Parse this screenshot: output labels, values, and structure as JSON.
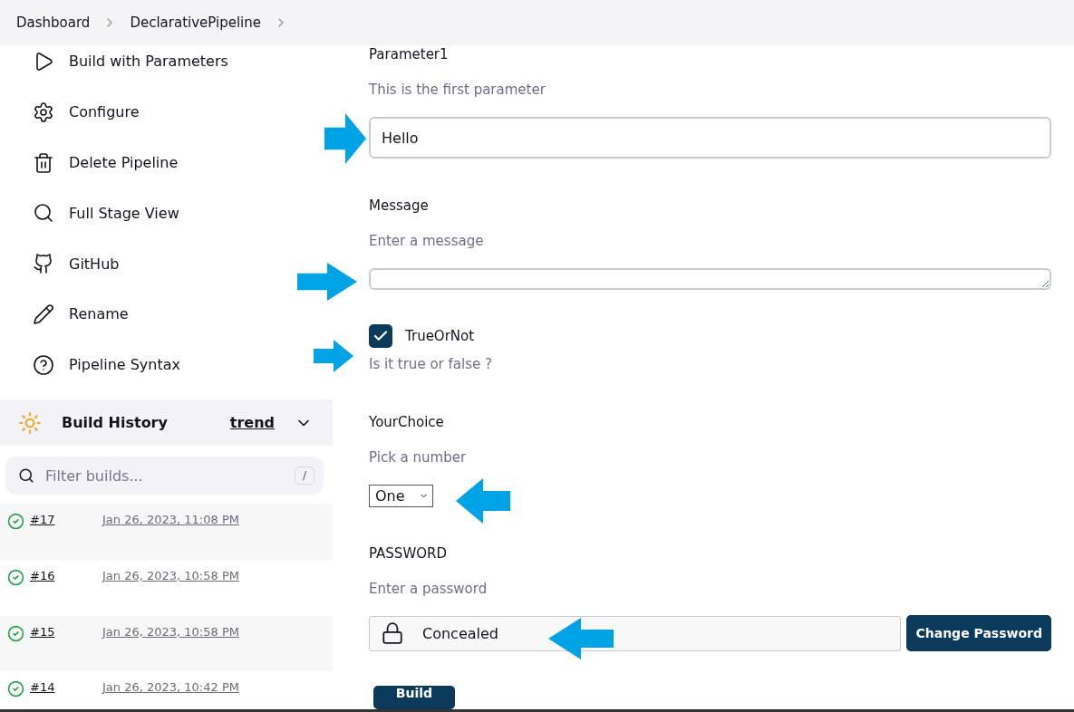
{
  "breadcrumbs": [
    {
      "label": "Dashboard"
    },
    {
      "label": "DeclarativePipeline"
    }
  ],
  "sidebar": {
    "items": [
      {
        "label": "Build with Parameters"
      },
      {
        "label": "Configure"
      },
      {
        "label": "Delete Pipeline"
      },
      {
        "label": "Full Stage View"
      },
      {
        "label": "GitHub"
      },
      {
        "label": "Rename"
      },
      {
        "label": "Pipeline Syntax"
      }
    ]
  },
  "build_history": {
    "title": "Build History",
    "trend": "trend",
    "filter_placeholder": "Filter builds...",
    "shortcut": "/",
    "builds": [
      {
        "number": "#17",
        "date": "Jan 26, 2023, 11:08 PM"
      },
      {
        "number": "#16",
        "date": "Jan 26, 2023, 10:58 PM"
      },
      {
        "number": "#15",
        "date": "Jan 26, 2023, 10:58 PM"
      },
      {
        "number": "#14",
        "date": "Jan 26, 2023, 10:42 PM"
      }
    ]
  },
  "parameters": [
    {
      "kind": "string",
      "name": "Parameter1",
      "description": "This is the first parameter",
      "value": "Hello"
    },
    {
      "kind": "text",
      "name": "Message",
      "description": "Enter a message"
    },
    {
      "kind": "boolean",
      "name": "TrueOrNot",
      "description": "Is it true or false ?",
      "checked": true
    },
    {
      "kind": "choice",
      "name": "YourChoice",
      "description": "Pick a number",
      "value": "One"
    },
    {
      "kind": "password",
      "name": "PASSWORD",
      "description": "Enter a password",
      "value": "Concealed",
      "button": "Change Password"
    }
  ],
  "build_button": "Build"
}
